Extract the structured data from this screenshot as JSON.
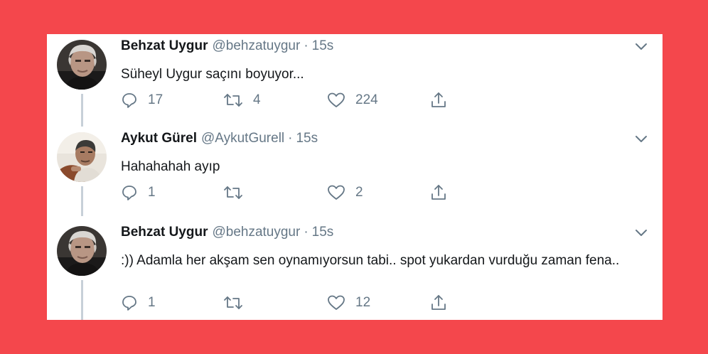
{
  "tweets": [
    {
      "name": "Behzat Uygur",
      "handle": "@behzatuygur",
      "dot": "·",
      "time": "15s",
      "text": "Süheyl Uygur saçını boyuyor...",
      "replies": "17",
      "retweets": "4",
      "likes": "224",
      "avatar": "gray-haired-man-avatar"
    },
    {
      "name": "Aykut Gürel",
      "handle": "@AykutGurell",
      "dot": "·",
      "time": "15s",
      "text": "Hahahahah ayıp",
      "replies": "1",
      "retweets": "",
      "likes": "2",
      "avatar": "dark-haired-man-avatar"
    },
    {
      "name": "Behzat Uygur",
      "handle": "@behzatuygur",
      "dot": "·",
      "time": "15s",
      "text": ":)) Adamla her akşam sen oynamıyorsun tabi.. spot yukardan vurduğu zaman fena..",
      "replies": "1",
      "retweets": "",
      "likes": "12",
      "avatar": "gray-haired-man-avatar"
    }
  ],
  "icons": {
    "reply": "reply-icon",
    "retweet": "retweet-icon",
    "like": "heart-icon",
    "share": "share-icon",
    "menu": "chevron-down-icon"
  },
  "colors": {
    "background": "#f4474c",
    "card": "#ffffff",
    "icon_gray": "#657786",
    "text": "#14171a"
  }
}
